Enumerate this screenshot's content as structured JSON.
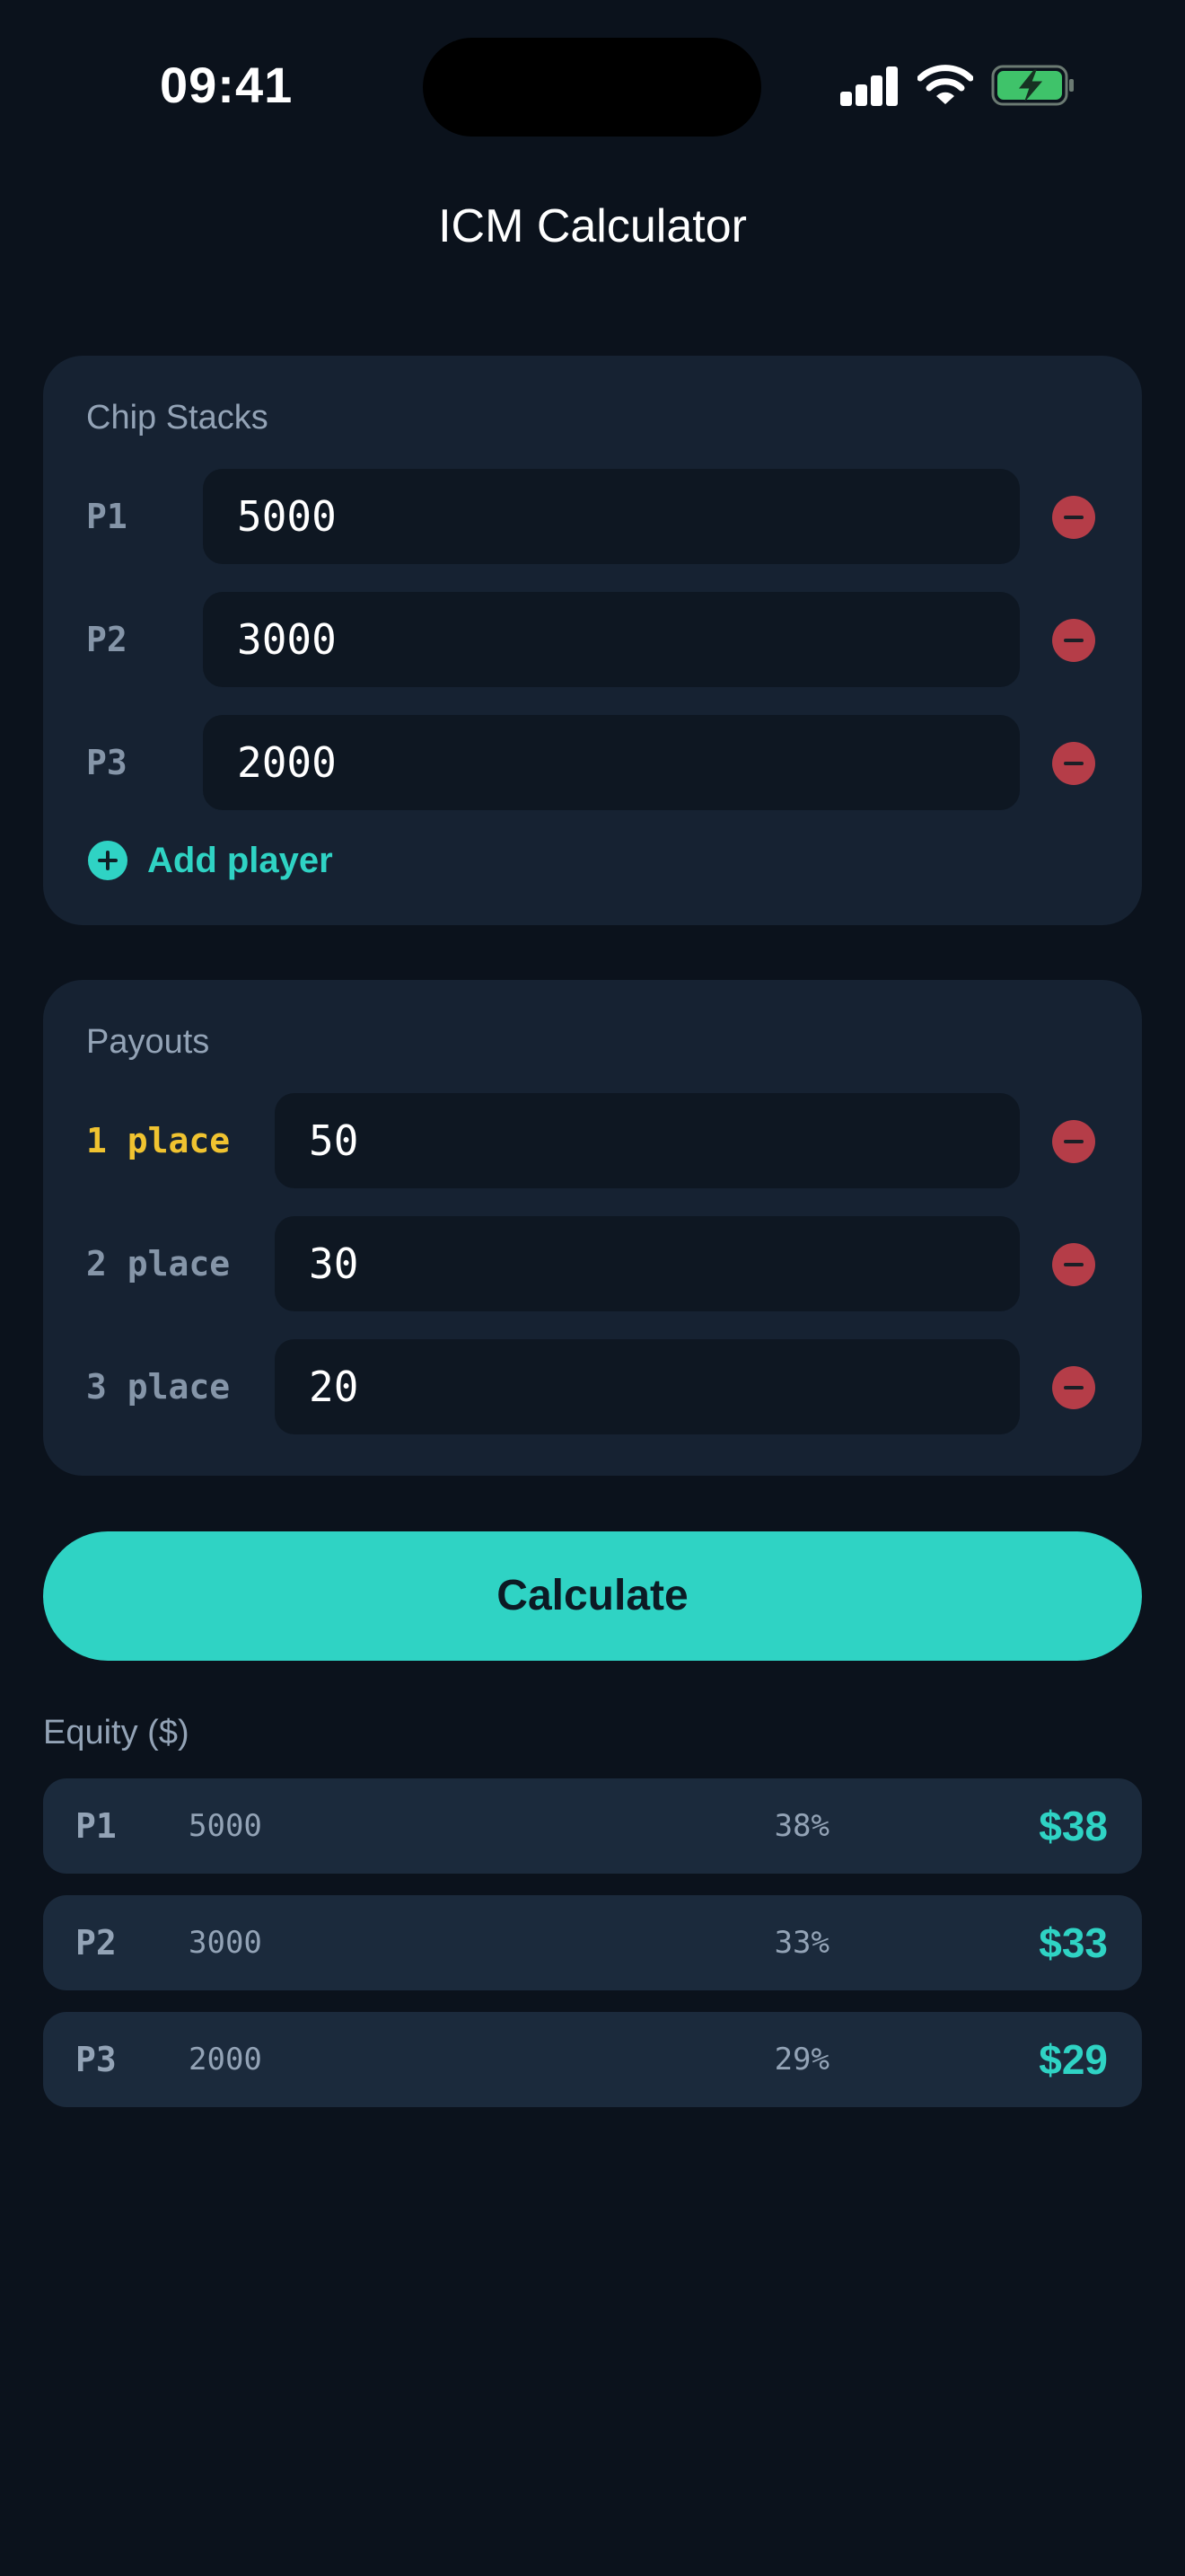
{
  "status_bar": {
    "time": "09:41"
  },
  "header": {
    "title": "ICM Calculator"
  },
  "chip_stacks": {
    "label": "Chip Stacks",
    "players": [
      {
        "label": "P1",
        "value": "5000"
      },
      {
        "label": "P2",
        "value": "3000"
      },
      {
        "label": "P3",
        "value": "2000"
      }
    ],
    "add_label": "Add player"
  },
  "payouts": {
    "label": "Payouts",
    "places": [
      {
        "label": "1 place",
        "value": "50"
      },
      {
        "label": "2 place",
        "value": "30"
      },
      {
        "label": "3 place",
        "value": "20"
      }
    ]
  },
  "calculate_label": "Calculate",
  "equity": {
    "label": "Equity ($)",
    "rows": [
      {
        "player": "P1",
        "chips": "5000",
        "percent": "38%",
        "value": "$38"
      },
      {
        "player": "P2",
        "chips": "3000",
        "percent": "33%",
        "value": "$33"
      },
      {
        "player": "P3",
        "chips": "2000",
        "percent": "29%",
        "value": "$29"
      }
    ]
  },
  "colors": {
    "background": "#0b121c",
    "card": "#162232",
    "accent": "#2fd3c4",
    "remove": "#b53d48",
    "first_place": "#f0c330"
  },
  "icons": [
    "cellular-signal-icon",
    "wifi-icon",
    "battery-charging-icon",
    "minus-circle-icon",
    "plus-circle-icon"
  ]
}
